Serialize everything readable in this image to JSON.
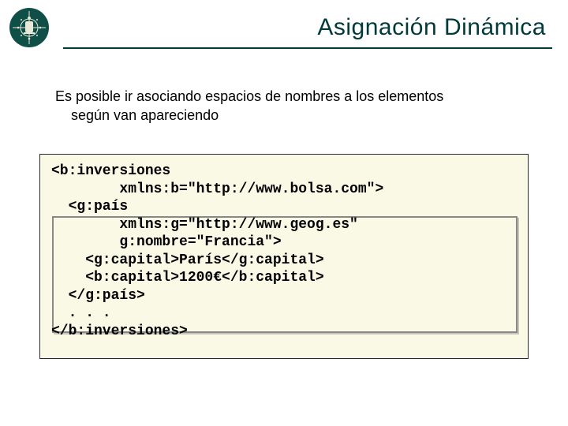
{
  "title": "Asignación Dinámica",
  "intro_line1": "Es posible ir asociando espacios de nombres a los elementos",
  "intro_line2": "según van apareciendo",
  "code": {
    "l1": "<b:inversiones",
    "l2": "        xmlns:b=\"http://www.bolsa.com\">",
    "l3": "  <g:país",
    "l4": "        xmlns:g=\"http://www.geog.es\"",
    "l5": "        g:nombre=\"Francia\">",
    "l6": "    <g:capital>París</g:capital>",
    "l7": "    <b:capital>1200€</b:capital>",
    "l8": "  </g:país>",
    "l9": "  . . .",
    "l10": "</b:inversiones>"
  },
  "logo_color": "#0f4f47"
}
